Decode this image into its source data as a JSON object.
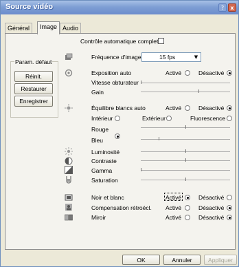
{
  "window": {
    "title": "Source vidéo",
    "help": "?",
    "close": "x"
  },
  "tabs": [
    "Général",
    "Image",
    "Audio"
  ],
  "auto_control": {
    "label": "Contrôle automatique complet",
    "checked": false
  },
  "defaults": {
    "title": "Param. défaut",
    "reset": "Réinit.",
    "restore": "Restaurer",
    "save": "Enregistrer"
  },
  "frame_rate": {
    "label": "Fréquence d'image",
    "value": "15 fps"
  },
  "exposure": {
    "label": "Exposition auto",
    "on": "Activé",
    "off": "Désactivé",
    "selected": "off",
    "shutter_label": "Vitesse obturateur",
    "gain_label": "Gain",
    "shutter_level": 0.0,
    "gain_level": 0.65
  },
  "white_balance": {
    "label": "Équilibre blancs auto",
    "on": "Activé",
    "off": "Désactivé",
    "selected": "off",
    "indoor": "Intérieur",
    "outdoor": "Extérieur",
    "fluorescent": "Fluorescence",
    "red_label": "Rouge",
    "blue_label": "Bleu",
    "red_level": 0.5,
    "blue_level": 0.2
  },
  "image_adjust": [
    {
      "label": "Luminosité",
      "level": 0.5
    },
    {
      "label": "Contraste",
      "level": 0.5
    },
    {
      "label": "Gamma",
      "level": 0.0
    },
    {
      "label": "Saturation",
      "level": 0.5
    }
  ],
  "toggles": [
    {
      "label": "Noir et blanc",
      "on": "Activé",
      "off": "Désactivé",
      "selected": "on"
    },
    {
      "label": "Compensation rétroécl.",
      "on": "Activé",
      "off": "Désactivé",
      "selected": "off"
    },
    {
      "label": "Miroir",
      "on": "Activé",
      "off": "Désactivé",
      "selected": "off"
    }
  ],
  "footer": {
    "ok": "OK",
    "cancel": "Annuler",
    "apply": "Appliquer"
  }
}
